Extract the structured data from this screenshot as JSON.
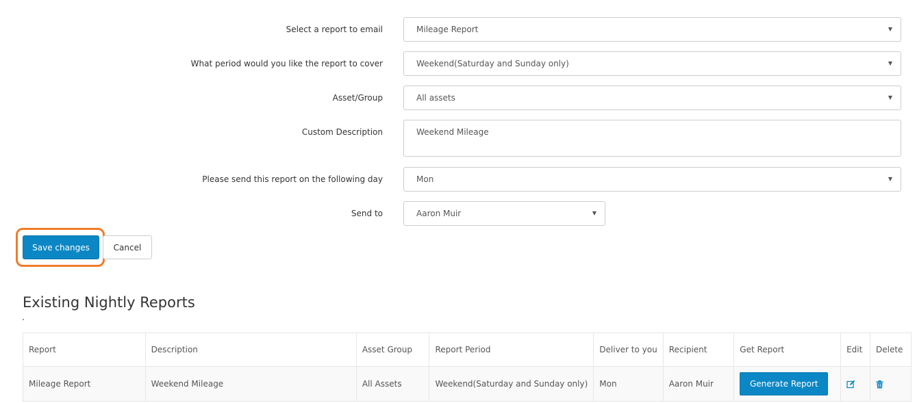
{
  "form": {
    "report": {
      "label": "Select a report to email",
      "value": "Mileage Report"
    },
    "period": {
      "label": "What period would you like the report to cover",
      "value": "Weekend(Saturday and Sunday only)"
    },
    "asset_group": {
      "label": "Asset/Group",
      "value": "All assets"
    },
    "custom_description": {
      "label": "Custom Description",
      "value": "Weekend Mileage"
    },
    "send_day": {
      "label": "Please send this report on the following day",
      "value": "Mon"
    },
    "send_to": {
      "label": "Send to",
      "value": "Aaron Muir"
    }
  },
  "actions": {
    "save_label": "Save changes",
    "cancel_label": "Cancel"
  },
  "existing": {
    "title": "Existing Nightly Reports",
    "columns": [
      "Report",
      "Description",
      "Asset Group",
      "Report Period",
      "Deliver to you",
      "Recipient",
      "Get Report",
      "Edit",
      "Delete"
    ],
    "rows": [
      {
        "report": "Mileage Report",
        "description": "Weekend Mileage",
        "asset_group": "All Assets",
        "report_period": "Weekend(Saturday and Sunday only)",
        "deliver": "Mon",
        "recipient": "Aaron Muir",
        "generate_label": "Generate Report"
      }
    ]
  },
  "icons": {
    "edit": "edit-icon",
    "delete": "trash-icon",
    "caret": "caret-down-icon"
  },
  "colors": {
    "primary": "#0b87c5",
    "highlight": "#f07c28"
  }
}
